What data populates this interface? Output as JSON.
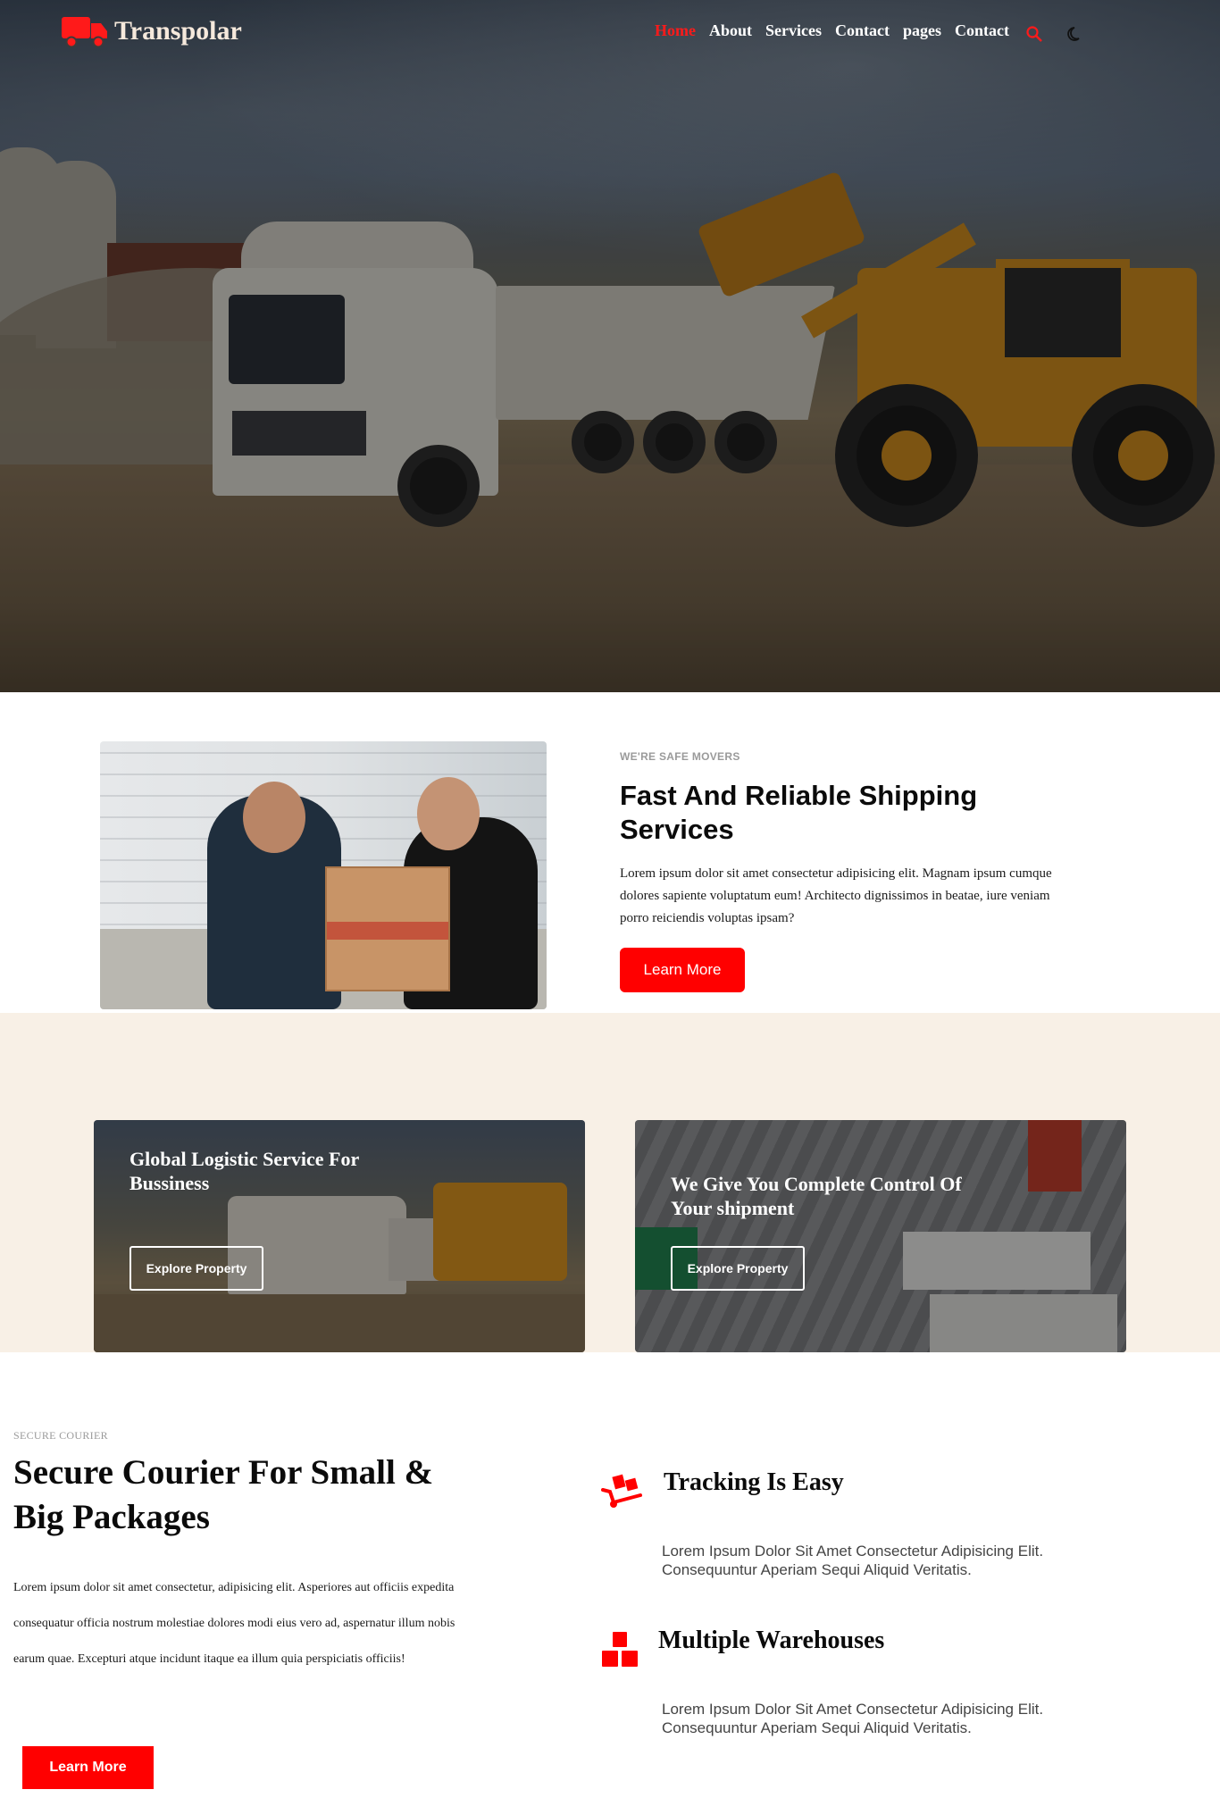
{
  "brand": {
    "name": "Transpolar",
    "accent": "#ff0000"
  },
  "nav": {
    "items": [
      {
        "label": "Home",
        "active": true
      },
      {
        "label": "About",
        "active": false
      },
      {
        "label": "Services",
        "active": false
      },
      {
        "label": "Contact",
        "active": false
      },
      {
        "label": "pages",
        "active": false
      },
      {
        "label": "Contact",
        "active": false
      }
    ],
    "icons": [
      "search-icon",
      "moon-icon"
    ]
  },
  "about": {
    "eyebrow": "WE'RE SAFE MOVERS",
    "title": "Fast And Reliable Shipping Services",
    "text": "Lorem ipsum dolor sit amet consectetur adipisicing elit. Magnam ipsum cumque dolores sapiente voluptatum eum! Architecto dignissimos in beatae, iure veniam porro reiciendis voluptas ipsam?",
    "button": "Learn More"
  },
  "cards": [
    {
      "title": "Global Logistic Service For Bussiness",
      "button": "Explore Property"
    },
    {
      "title": "We Give You Complete Control Of Your shipment",
      "button": "Explore Property"
    }
  ],
  "courier": {
    "eyebrow": "SECURE COURIER",
    "title": "Secure Courier For Small & Big Packages",
    "text": "Lorem ipsum dolor sit amet consectetur, adipisicing elit. Asperiores aut officiis expedita consequatur officia nostrum molestiae dolores modi eius vero ad, aspernatur illum nobis earum quae. Excepturi atque incidunt itaque ea illum quia perspiciatis officiis!",
    "button": "Learn More",
    "features": [
      {
        "icon": "dolly-icon",
        "title": "Tracking Is Easy",
        "text": "Lorem Ipsum Dolor Sit Amet Consectetur Adipisicing Elit. Consequuntur Aperiam Sequi Aliquid Veritatis."
      },
      {
        "icon": "boxes-icon",
        "title": "Multiple Warehouses",
        "text": "Lorem Ipsum Dolor Sit Amet Consectetur Adipisicing Elit. Consequuntur Aperiam Sequi Aliquid Veritatis."
      }
    ]
  },
  "hero_image": "truck-and-loader-photo"
}
